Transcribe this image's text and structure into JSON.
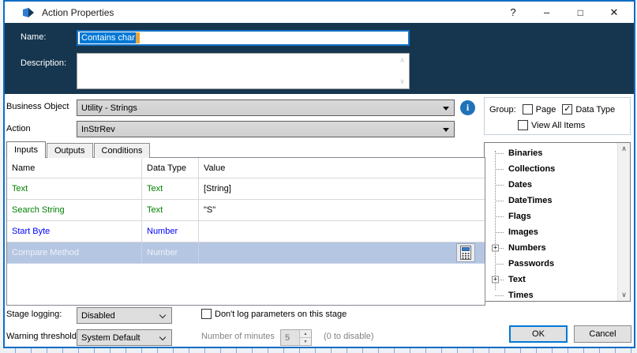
{
  "window": {
    "title": "Action Properties",
    "controls": {
      "help": "?",
      "minimize": "–",
      "maximize": "□",
      "close": "✕"
    }
  },
  "header": {
    "name_label": "Name:",
    "name_value": "Contains char",
    "description_label": "Description:",
    "description_value": ""
  },
  "selectors": {
    "business_object_label": "Business Object",
    "business_object_value": "Utility - Strings",
    "action_label": "Action",
    "action_value": "InStrRev",
    "info_glyph": "i"
  },
  "group_box": {
    "label": "Group:",
    "page": {
      "label": "Page",
      "checked": false
    },
    "data_type": {
      "label": "Data Type",
      "checked": true
    },
    "view_all": {
      "label": "View All Items",
      "checked": false
    },
    "check_glyph": "✓"
  },
  "tabs": {
    "inputs": "Inputs",
    "outputs": "Outputs",
    "conditions": "Conditions"
  },
  "params_table": {
    "headers": {
      "name": "Name",
      "data_type": "Data Type",
      "value": "Value"
    },
    "rows": [
      {
        "name": "Text",
        "data_type": "Text",
        "value": "[String]",
        "type_color": "green",
        "selected": false
      },
      {
        "name": "Search String",
        "data_type": "Text",
        "value": "\"S\"",
        "type_color": "green",
        "selected": false
      },
      {
        "name": "Start Byte",
        "data_type": "Number",
        "value": "",
        "type_color": "blue",
        "selected": false
      },
      {
        "name": "Compare Method",
        "data_type": "Number",
        "value": "",
        "type_color": "blue",
        "selected": true
      }
    ]
  },
  "data_tree": {
    "items": [
      {
        "label": "Binaries",
        "expandable": false
      },
      {
        "label": "Collections",
        "expandable": false
      },
      {
        "label": "Dates",
        "expandable": false
      },
      {
        "label": "DateTimes",
        "expandable": false
      },
      {
        "label": "Flags",
        "expandable": false
      },
      {
        "label": "Images",
        "expandable": false
      },
      {
        "label": "Numbers",
        "expandable": true
      },
      {
        "label": "Passwords",
        "expandable": false
      },
      {
        "label": "Text",
        "expandable": true
      },
      {
        "label": "Times",
        "expandable": false
      }
    ],
    "expander_glyph": "+"
  },
  "footer": {
    "stage_logging_label": "Stage logging:",
    "stage_logging_value": "Disabled",
    "dont_log_label": "Don't log parameters on this stage",
    "warning_threshold_label": "Warning threshold:",
    "warning_threshold_value": "System Default",
    "minutes_label": "Number of minutes",
    "minutes_value": "5",
    "minutes_hint": "(0 to disable)",
    "ok_label": "OK",
    "cancel_label": "Cancel"
  },
  "colors": {
    "header_navy": "#16364F",
    "dialog_border": "#0E6CC2",
    "selection_blue": "#0078D7",
    "caret_orange": "#E8A33C",
    "selected_row_bg": "#B5C6E2",
    "type_green": "#008000",
    "type_blue": "#0000FF",
    "info_blue": "#1F72B8"
  }
}
